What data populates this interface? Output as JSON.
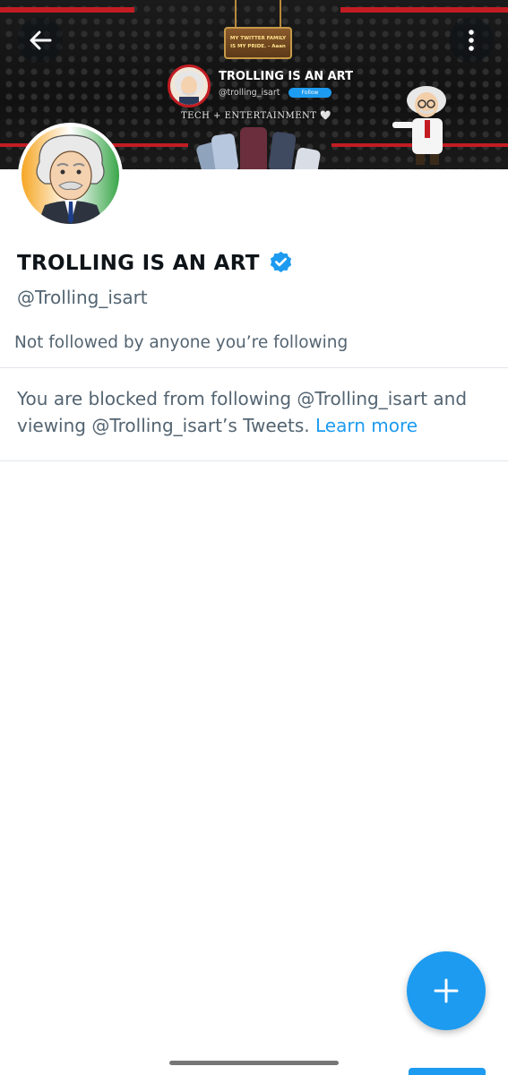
{
  "banner": {
    "sign_line1": "MY TWITTER FAMILY",
    "sign_line2": "IS MY PRIDE. - Aaan",
    "name": "TROLLING IS AN ART",
    "handle": "@trolling_isart",
    "follow_label": "Follow",
    "tagline": "TECH + ENTERTAINMENT 🤍"
  },
  "profile": {
    "name": "TROLLING IS AN ART",
    "handle": "@Trolling_isart",
    "followed_by": "Not followed by anyone you’re following"
  },
  "blocked": {
    "message": "You are blocked from following @Trolling_isart and viewing @Trolling_isart’s Tweets.",
    "learn_more": "Learn more"
  },
  "colors": {
    "accent": "#1d9bf0",
    "secondary_text": "#536471",
    "banner_red": "#c21d23"
  },
  "icons": {
    "back": "arrow-left-icon",
    "more": "more-vertical-icon",
    "verified": "verified-badge-icon",
    "compose": "plus-icon"
  }
}
